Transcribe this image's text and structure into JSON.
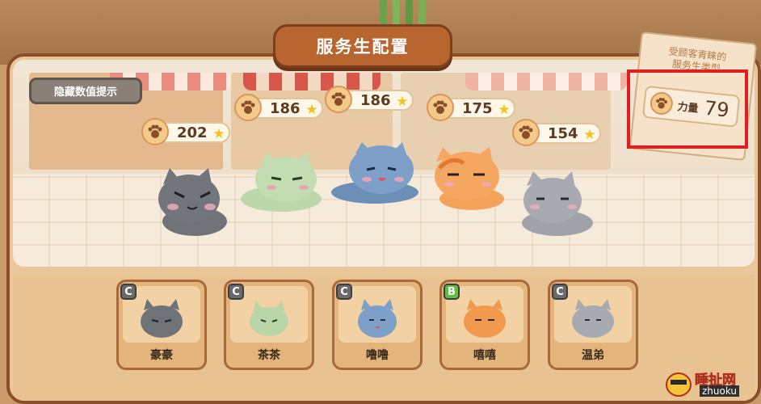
{
  "title": "服务生配置",
  "hide_button": "隐藏数值提示",
  "bubbles": [
    {
      "value": "202"
    },
    {
      "value": "186"
    },
    {
      "value": "186"
    },
    {
      "value": "175"
    },
    {
      "value": "154"
    }
  ],
  "info_card": {
    "heading_line1": "受顾客青睐的",
    "heading_line2": "服务生类型",
    "stat_label": "力量",
    "stat_value": "79"
  },
  "roster": [
    {
      "name": "豪豪",
      "rank": "C",
      "color": "#6f7378"
    },
    {
      "name": "茶茶",
      "rank": "C",
      "color": "#b9d6a8"
    },
    {
      "name": "噜噜",
      "rank": "C",
      "color": "#7e9fc7"
    },
    {
      "name": "嘻嘻",
      "rank": "B",
      "color": "#f19a4e"
    },
    {
      "name": "温弟",
      "rank": "C",
      "color": "#a7aab0"
    }
  ],
  "watermark": {
    "line1": "睡扯网",
    "line2": "zhuoku"
  }
}
